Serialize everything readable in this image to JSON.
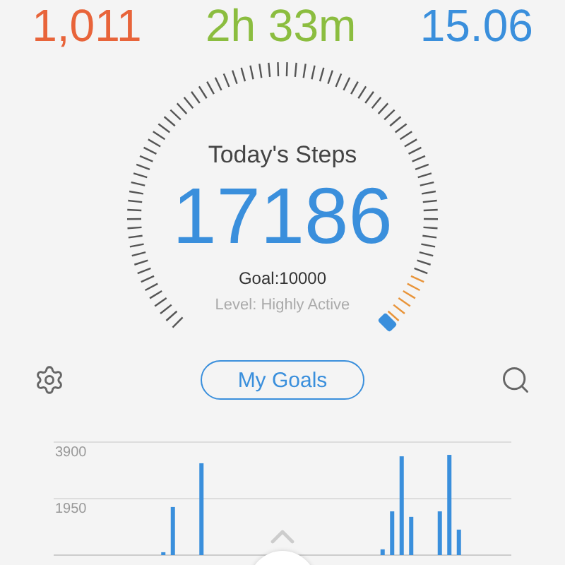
{
  "stats": [
    {
      "value": "1,011",
      "color": "#e8643a"
    },
    {
      "value": "2h 33m",
      "color": "#8bbd3f"
    },
    {
      "value": "15.06",
      "color": "#3a8fdc"
    }
  ],
  "steps": {
    "title": "Today's Steps",
    "count": "17186",
    "goal": "Goal:10000",
    "level_text": "Level: Highly Active"
  },
  "goals_button": "My Goals",
  "chart_data": {
    "type": "bar",
    "ylim": [
      0,
      3900
    ],
    "yticks": [
      1950,
      3900
    ],
    "values": [
      0,
      0,
      0,
      0,
      0,
      0,
      0,
      0,
      0,
      0,
      0,
      100,
      1660,
      0,
      0,
      3170,
      0,
      0,
      0,
      0,
      0,
      0,
      0,
      0,
      0,
      0,
      0,
      0,
      0,
      0,
      0,
      0,
      0,
      0,
      200,
      1510,
      3410,
      1320,
      0,
      0,
      1510,
      3460,
      880,
      0,
      0,
      0,
      0,
      0
    ]
  }
}
